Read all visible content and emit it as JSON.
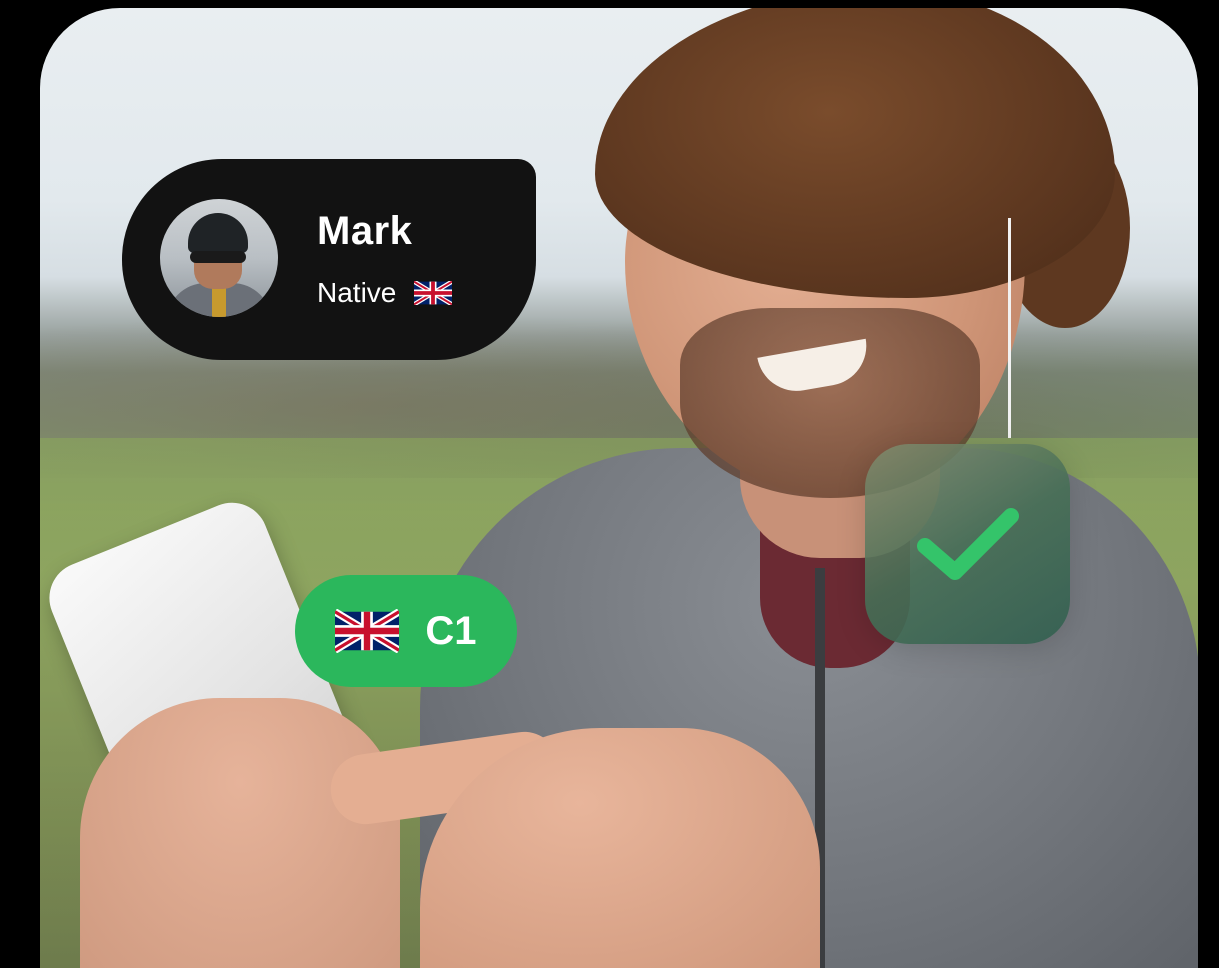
{
  "profile": {
    "name": "Mark",
    "level_label": "Native",
    "flag_icon": "uk-flag-icon"
  },
  "badge": {
    "level": "C1",
    "flag_icon": "uk-flag-icon",
    "color": "#2bb75c"
  },
  "check_tile": {
    "icon": "check-icon",
    "check_color": "#34c46a"
  },
  "colors": {
    "page_background": "#000000",
    "card_background": "#121212",
    "badge_green": "#2bb75c"
  }
}
